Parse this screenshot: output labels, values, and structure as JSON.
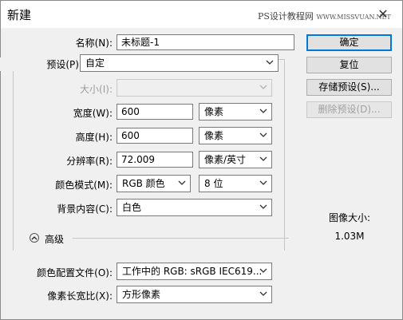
{
  "window": {
    "title": "新建",
    "watermark_main": "PS设计教程网",
    "watermark_sub": "WWW.MISSVUAN.NET"
  },
  "form": {
    "name": {
      "label": "名称(N):",
      "value": "未标题-1"
    },
    "preset": {
      "label": "预设(P):",
      "value": "自定"
    },
    "size": {
      "label": "大小(I):",
      "value": ""
    },
    "width": {
      "label": "宽度(W):",
      "value": "600",
      "unit": "像素"
    },
    "height": {
      "label": "高度(H):",
      "value": "600",
      "unit": "像素"
    },
    "resolution": {
      "label": "分辨率(R):",
      "value": "72.009",
      "unit": "像素/英寸"
    },
    "color_mode": {
      "label": "颜色模式(M):",
      "value": "RGB 颜色",
      "depth": "8 位"
    },
    "background": {
      "label": "背景内容(C):",
      "value": "白色"
    },
    "advanced": {
      "label": "高级"
    },
    "color_profile": {
      "label": "颜色配置文件(O):",
      "value": "工作中的 RGB: sRGB IEC619..."
    },
    "pixel_aspect": {
      "label": "像素长宽比(X):",
      "value": "方形像素"
    }
  },
  "buttons": {
    "ok": "确定",
    "reset": "复位",
    "save_preset": "存储预设(S)...",
    "delete_preset": "删除预设(D)..."
  },
  "image_size": {
    "label": "图像大小:",
    "value": "1.03M"
  }
}
